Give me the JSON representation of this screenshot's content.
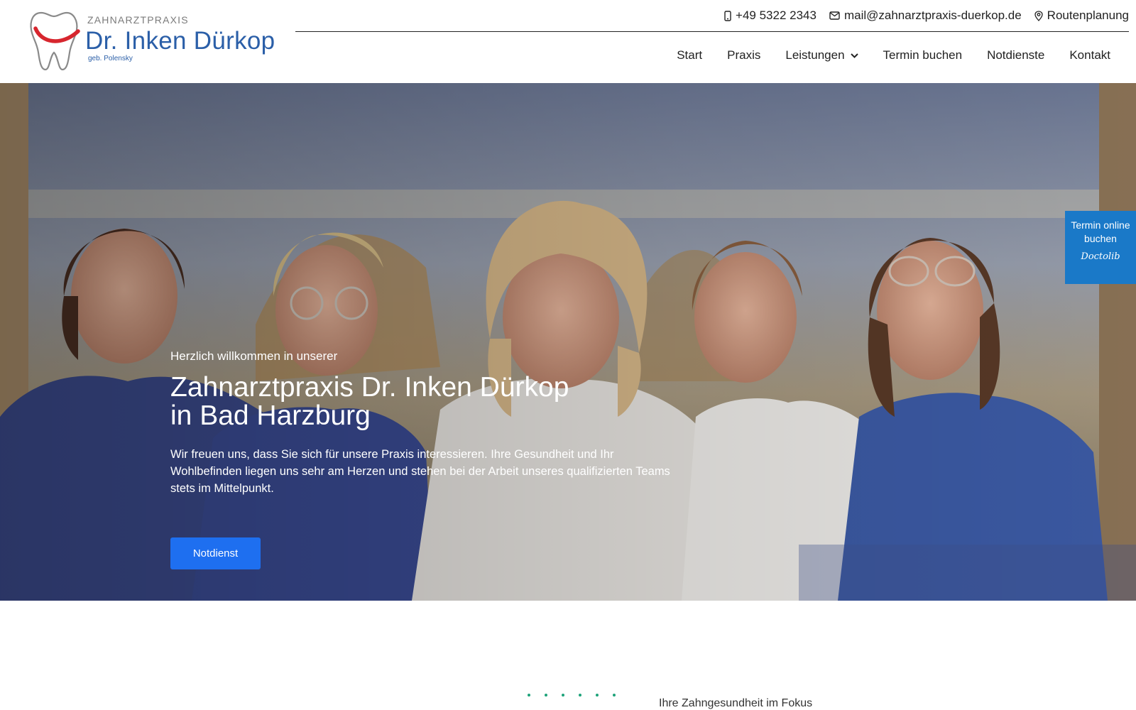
{
  "header": {
    "logo": {
      "pre": "ZAHNARZTPRAXIS",
      "name": "Dr. Inken Dürkop",
      "sub": "geb. Polensky"
    },
    "contact": {
      "phone": "+49 5322 2343",
      "email": "mail@zahnarztpraxis-duerkop.de",
      "route": "Routenplanung"
    },
    "nav": {
      "start": "Start",
      "praxis": "Praxis",
      "leistungen": "Leistungen",
      "termin": "Termin buchen",
      "notdienste": "Notdienste",
      "kontakt": "Kontakt"
    }
  },
  "hero": {
    "pre": "Herzlich willkommen in unserer",
    "title_line1": "Zahnarztpraxis Dr. Inken Dürkop",
    "title_line2": "in Bad Harzburg",
    "description": "Wir freuen uns, dass Sie sich für unsere Praxis interessieren. Ihre Gesundheit und Ihr Wohlbefinden liegen uns sehr am Herzen und stehen bei der Arbeit unseres qualifizierten Teams stets im Mittelpunkt.",
    "button": "Notdienst"
  },
  "doctolib": {
    "label": "Termin online buchen",
    "brand": "Doctolib"
  },
  "section": {
    "heading": "Ihre Zahngesundheit im Fokus"
  },
  "icons": {
    "phone": "phone-icon",
    "email": "envelope-icon",
    "route": "map-pin-icon",
    "dropdown": "chevron-down-icon"
  },
  "colors": {
    "brand_blue": "#2b5fa8",
    "logo_red": "#d7262e",
    "button_blue": "#1e6ff0",
    "doctolib_blue": "#1a79c8",
    "dot_green": "#1ea37a"
  }
}
